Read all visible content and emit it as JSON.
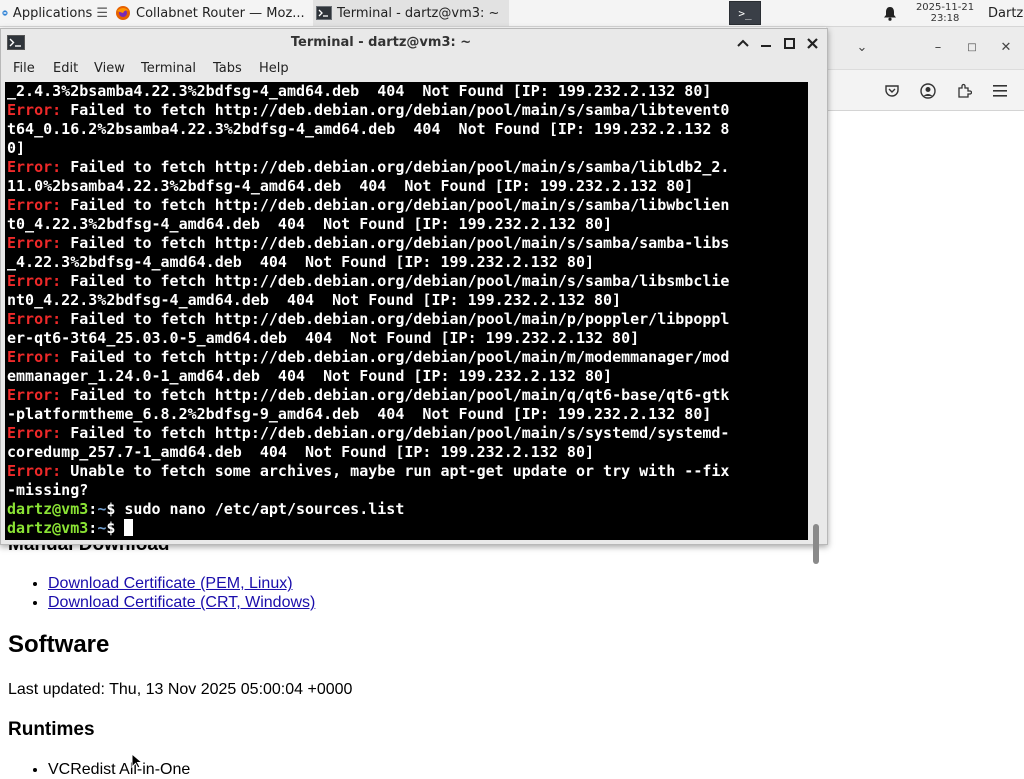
{
  "panel": {
    "apps_label": "Applications",
    "tasks": [
      {
        "label": "Collabnet Router — Moz..."
      },
      {
        "label": "Terminal - dartz@vm3: ~"
      }
    ],
    "launcher_glyph": ">_",
    "clock_date": "2025-11-21",
    "clock_time": "23:18",
    "user": "Dartz"
  },
  "terminal": {
    "title": "Terminal - dartz@vm3: ~",
    "menu": [
      "File",
      "Edit",
      "View",
      "Terminal",
      "Tabs",
      "Help"
    ],
    "lines": [
      {
        "type": "plain",
        "text": "_2.4.3%2bsamba4.22.3%2bdfsg-4_amd64.deb  404  Not Found [IP: 199.232.2.132 80]"
      },
      {
        "type": "err",
        "label": "Error:",
        "text": " Failed to fetch http://deb.debian.org/debian/pool/main/s/samba/libtevent0"
      },
      {
        "type": "plain",
        "text": "t64_0.16.2%2bsamba4.22.3%2bdfsg-4_amd64.deb  404  Not Found [IP: 199.232.2.132 8"
      },
      {
        "type": "plain",
        "text": "0]"
      },
      {
        "type": "err",
        "label": "Error:",
        "text": " Failed to fetch http://deb.debian.org/debian/pool/main/s/samba/libldb2_2."
      },
      {
        "type": "plain",
        "text": "11.0%2bsamba4.22.3%2bdfsg-4_amd64.deb  404  Not Found [IP: 199.232.2.132 80]"
      },
      {
        "type": "err",
        "label": "Error:",
        "text": " Failed to fetch http://deb.debian.org/debian/pool/main/s/samba/libwbclien"
      },
      {
        "type": "plain",
        "text": "t0_4.22.3%2bdfsg-4_amd64.deb  404  Not Found [IP: 199.232.2.132 80]"
      },
      {
        "type": "err",
        "label": "Error:",
        "text": " Failed to fetch http://deb.debian.org/debian/pool/main/s/samba/samba-libs"
      },
      {
        "type": "plain",
        "text": "_4.22.3%2bdfsg-4_amd64.deb  404  Not Found [IP: 199.232.2.132 80]"
      },
      {
        "type": "err",
        "label": "Error:",
        "text": " Failed to fetch http://deb.debian.org/debian/pool/main/s/samba/libsmbclie"
      },
      {
        "type": "plain",
        "text": "nt0_4.22.3%2bdfsg-4_amd64.deb  404  Not Found [IP: 199.232.2.132 80]"
      },
      {
        "type": "err",
        "label": "Error:",
        "text": " Failed to fetch http://deb.debian.org/debian/pool/main/p/poppler/libpoppl"
      },
      {
        "type": "plain",
        "text": "er-qt6-3t64_25.03.0-5_amd64.deb  404  Not Found [IP: 199.232.2.132 80]"
      },
      {
        "type": "err",
        "label": "Error:",
        "text": " Failed to fetch http://deb.debian.org/debian/pool/main/m/modemmanager/mod"
      },
      {
        "type": "plain",
        "text": "emmanager_1.24.0-1_amd64.deb  404  Not Found [IP: 199.232.2.132 80]"
      },
      {
        "type": "err",
        "label": "Error:",
        "text": " Failed to fetch http://deb.debian.org/debian/pool/main/q/qt6-base/qt6-gtk"
      },
      {
        "type": "plain",
        "text": "-platformtheme_6.8.2%2bdfsg-9_amd64.deb  404  Not Found [IP: 199.232.2.132 80]"
      },
      {
        "type": "err",
        "label": "Error:",
        "text": " Failed to fetch http://deb.debian.org/debian/pool/main/s/systemd/systemd-"
      },
      {
        "type": "plain",
        "text": "coredump_257.7-1_amd64.deb  404  Not Found [IP: 199.232.2.132 80]"
      },
      {
        "type": "err",
        "label": "Error:",
        "text": " Unable to fetch some archives, maybe run apt-get update or try with --fix"
      },
      {
        "type": "plain",
        "text": "-missing?"
      },
      {
        "type": "prompt",
        "user": "dartz@vm3",
        "dir": "~",
        "cmd": "sudo nano /etc/apt/sources.list"
      },
      {
        "type": "prompt",
        "user": "dartz@vm3",
        "dir": "~",
        "cmd": "",
        "cursor": true
      }
    ]
  },
  "webpage": {
    "manual_heading": "Manual Download",
    "cert_links": [
      "Download Certificate (PEM, Linux)",
      "Download Certificate (CRT, Windows)"
    ],
    "software_heading": "Software",
    "last_updated": "Last updated: Thu, 13 Nov 2025 05:00:04 +0000",
    "runtimes_heading": "Runtimes",
    "runtime_items": [
      "VCRedist All-in-One"
    ]
  },
  "colors": {
    "error": "#ef2929",
    "prompt_user": "#8ae234",
    "prompt_dir": "#729fcf",
    "link": "#1a0dab"
  }
}
